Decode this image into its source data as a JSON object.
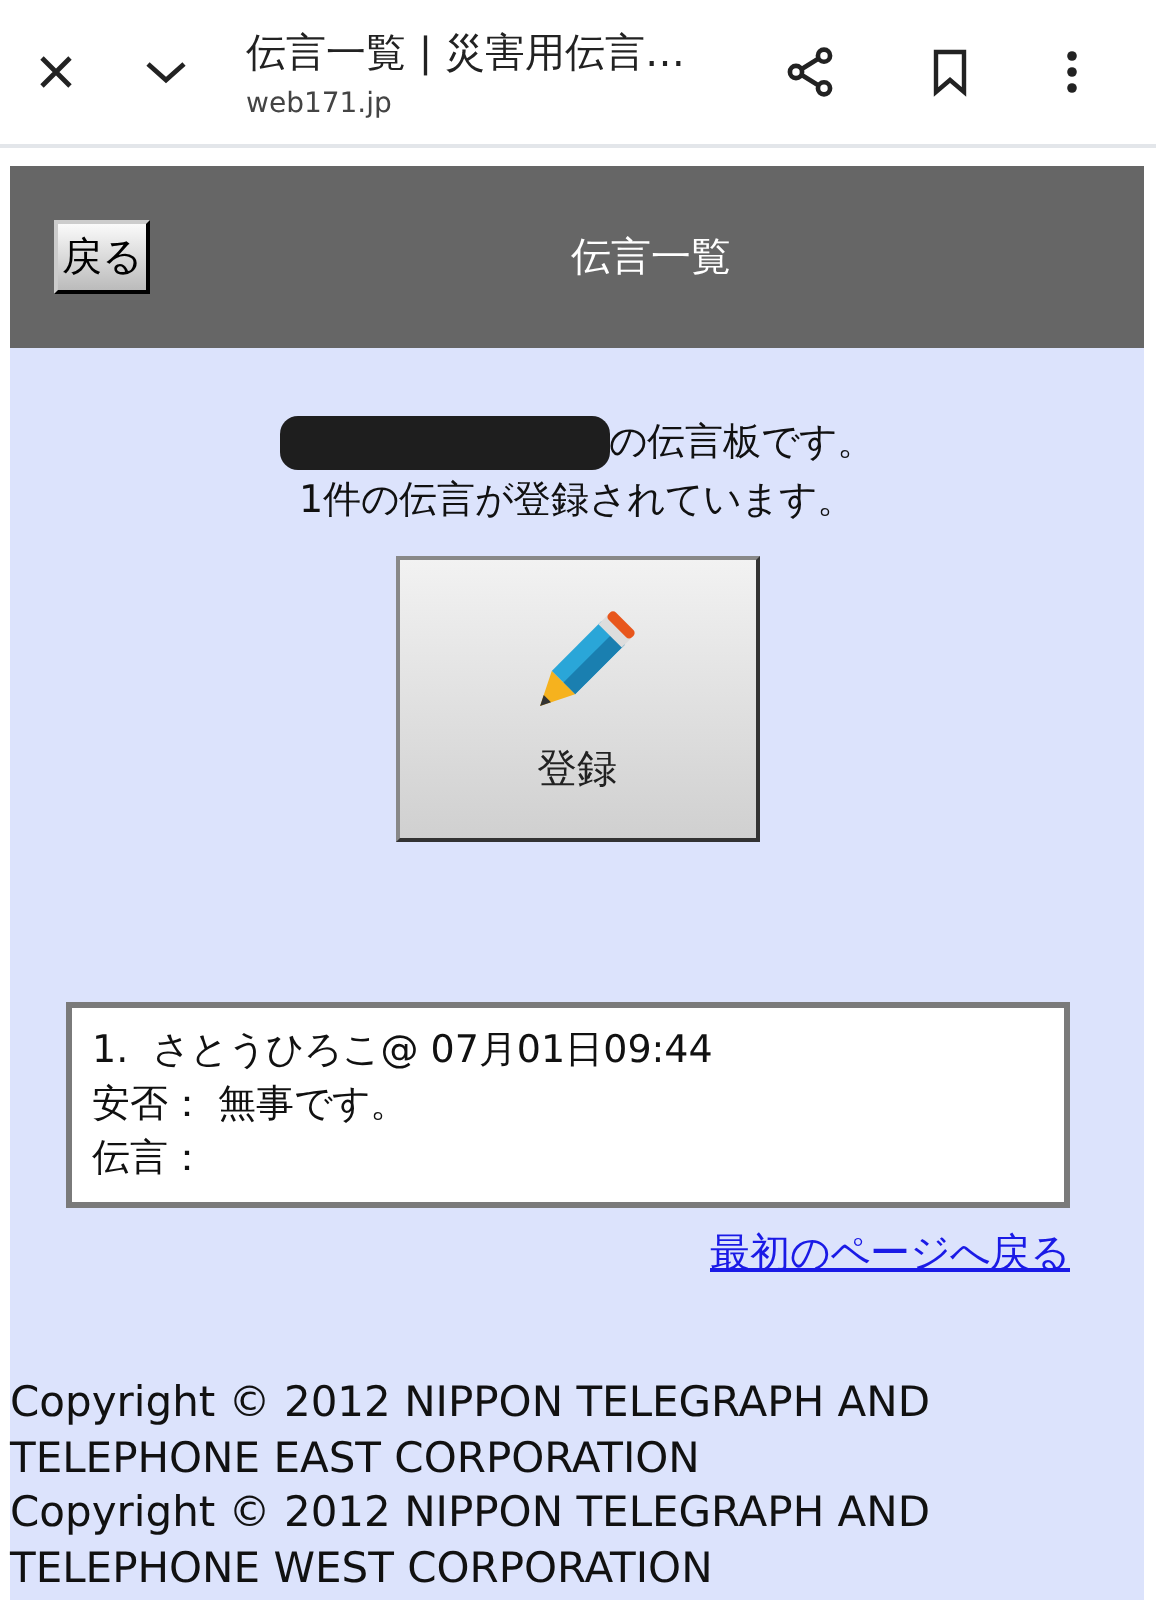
{
  "browser": {
    "title": "伝言一覧 | 災害用伝言…",
    "url": "web171.jp"
  },
  "header": {
    "back_button": "戻る",
    "title": "伝言一覧"
  },
  "intro": {
    "redacted": true,
    "board_suffix": "の伝言板です。",
    "count_line": "1件の伝言が登録されています。"
  },
  "register_button": {
    "label": "登録"
  },
  "messages": [
    {
      "lines": [
        "1.  さとうひろこ@ 07月01日09:44",
        "安否： 無事です。",
        "伝言："
      ]
    }
  ],
  "top_link": "最初のページへ戻る",
  "copyright": [
    "Copyright © 2012 NIPPON TELEGRAPH AND TELEPHONE EAST CORPORATION",
    "Copyright © 2012 NIPPON TELEGRAPH AND TELEPHONE WEST CORPORATION"
  ]
}
